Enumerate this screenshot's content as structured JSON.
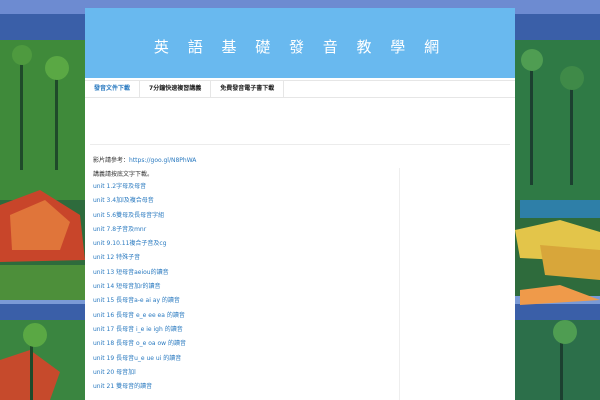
{
  "site": {
    "title": "英 語 基 礎 發 音 教 學 網"
  },
  "nav": {
    "tabs": [
      {
        "label": "發音文件下載",
        "active": true
      },
      {
        "label": "7分鐘快速複習講義",
        "active": false
      },
      {
        "label": "免費發音電子書下載",
        "active": false
      }
    ]
  },
  "content": {
    "ref_label": "影片請參考：",
    "ref_link": "https://goo.gl/N8PhWA",
    "intro": "講義請按底文字下載。",
    "units": [
      "unit 1.2字母及母音",
      "unit 3.4加l及複合母音",
      "unit 5.6雙母及長母音字組",
      "unit 7.8子音及mnr",
      "unit 9.10.11複合子音及cg",
      "unit 12 特殊子音",
      "unit 13 短母音aeiou的讀音",
      "unit 14 短母音加r的讀音",
      "unit 15 長母音a-e ai ay 的讀音",
      "unit 16 長母音 e_e ee ea 的讀音",
      "unit 17 長母音 i_e ie igh 的讀音",
      "unit 18 長母音 o_e oa ow 的讀音",
      "unit 19 長母音u_e ue ui 的讀音",
      "unit 20 母音加l",
      "unit 21 雙母音的讀音"
    ]
  },
  "colors": {
    "header": "#69b9ef",
    "link": "#2a7ac0",
    "background_painting": "#2f6f3a"
  }
}
